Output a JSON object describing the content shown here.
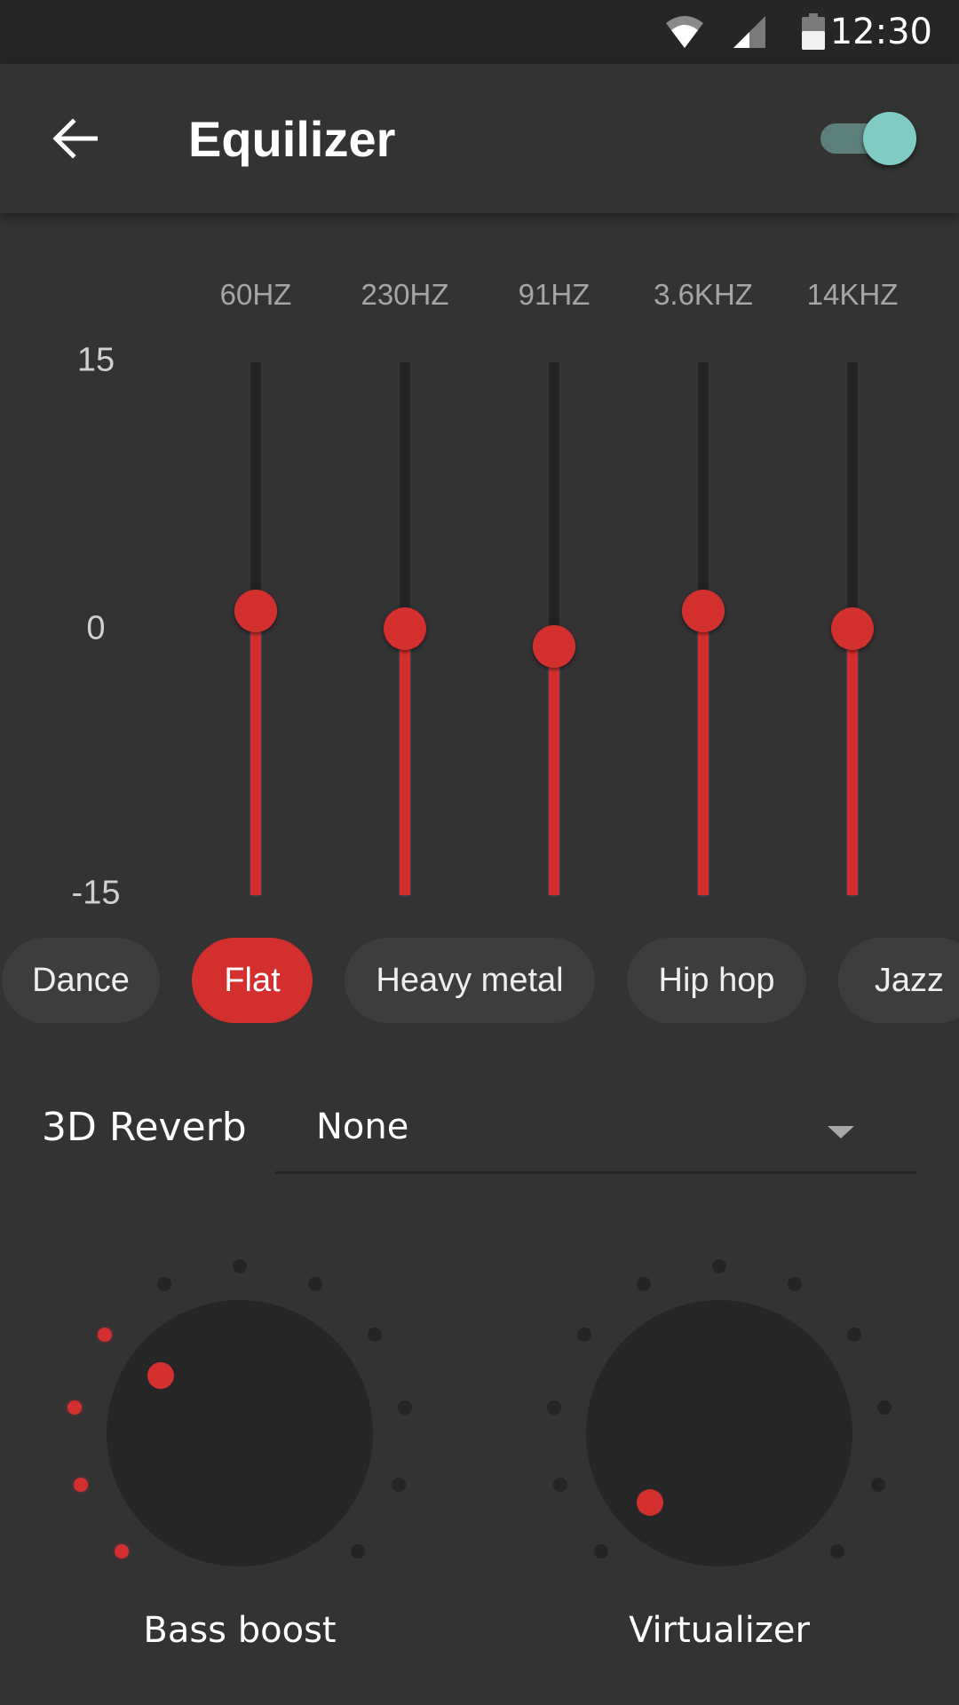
{
  "status_bar": {
    "time": "12:30",
    "icons": [
      "wifi-icon",
      "cellular-signal-icon",
      "battery-icon"
    ]
  },
  "app_bar": {
    "back_icon": "arrow-left-icon",
    "title": "Equilizer",
    "enabled": true,
    "colors": {
      "toggle_knob": "#80cbc4",
      "toggle_track": "#5d7f7c"
    }
  },
  "equalizer": {
    "db_range": {
      "max": 15,
      "min": -15
    },
    "db_labels": [
      "15",
      "0",
      "-15"
    ],
    "bands": [
      {
        "label": "60HZ",
        "value_db": 1
      },
      {
        "label": "230HZ",
        "value_db": 0
      },
      {
        "label": "91HZ",
        "value_db": -1
      },
      {
        "label": "3.6KHZ",
        "value_db": 1
      },
      {
        "label": "14KHZ",
        "value_db": 0
      }
    ],
    "accent_color": "#d32f2f"
  },
  "presets": {
    "items": [
      {
        "label": "Dance",
        "active": false
      },
      {
        "label": "Flat",
        "active": true
      },
      {
        "label": "Heavy metal",
        "active": false
      },
      {
        "label": "Hip hop",
        "active": false
      },
      {
        "label": "Jazz",
        "active": false
      }
    ]
  },
  "reverb": {
    "label": "3D Reverb",
    "selected": "None"
  },
  "knobs": [
    {
      "label": "Bass boost",
      "level_steps": 4,
      "total_steps": 11
    },
    {
      "label": "Virtualizer",
      "level_steps": 0,
      "total_steps": 11
    }
  ]
}
